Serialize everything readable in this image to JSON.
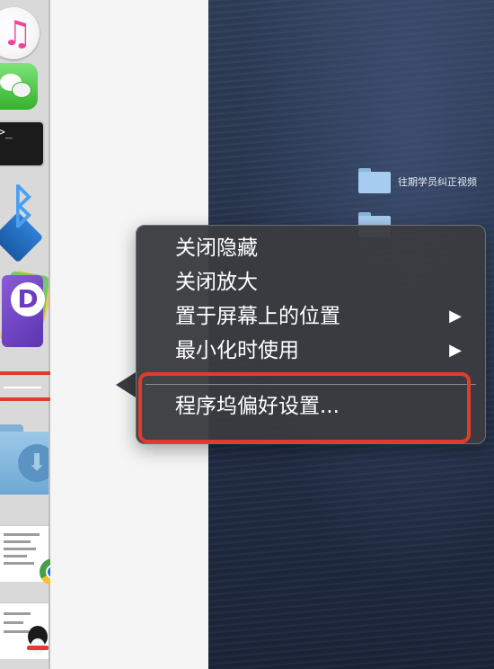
{
  "dock": {
    "items": [
      {
        "icon": "itunes-icon"
      },
      {
        "icon": "wechat-icon"
      },
      {
        "icon": "terminal-icon",
        "text": ">_"
      },
      {
        "icon": "bluetooth-icon"
      },
      {
        "icon": "dash-icon",
        "text": "D"
      },
      {
        "icon": "dock-separator"
      },
      {
        "icon": "downloads-folder-icon"
      },
      {
        "icon": "chrome-window-thumbnail"
      },
      {
        "icon": "qq-window-thumbnail"
      }
    ]
  },
  "desktop": {
    "folders": [
      {
        "label": "往期学员纠正视频"
      },
      {
        "label": ""
      }
    ]
  },
  "context_menu": {
    "items": [
      {
        "label": "关闭隐藏",
        "submenu": false
      },
      {
        "label": "关闭放大",
        "submenu": false
      },
      {
        "label": "置于屏幕上的位置",
        "submenu": true,
        "arrow": "▶"
      },
      {
        "label": "最小化时使用",
        "submenu": true,
        "arrow": "▶"
      }
    ],
    "preferences_label": "程序坞偏好设置..."
  },
  "annotation_colors": {
    "highlight": "#e03c2c"
  }
}
